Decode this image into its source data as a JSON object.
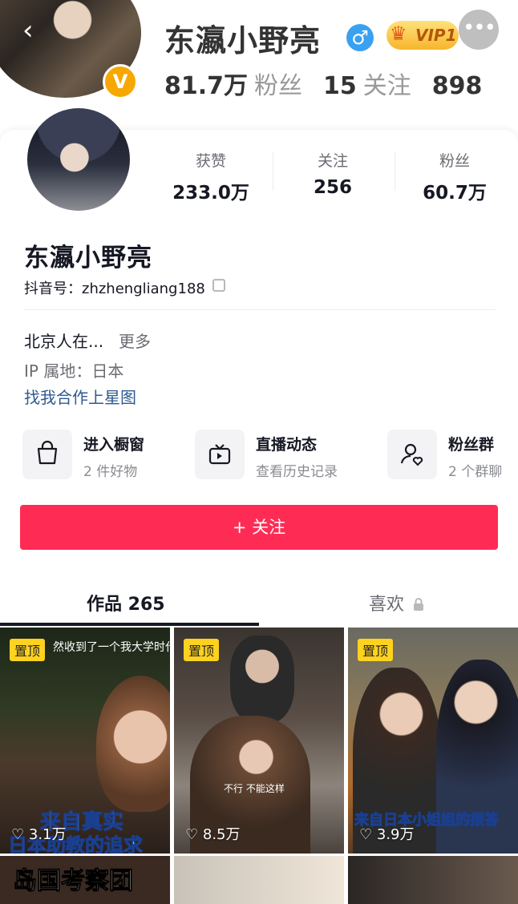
{
  "weibo": {
    "name": "东瀛小野亮",
    "gender_icon": "♂",
    "vip_badge": "VIP1",
    "verified_badge": "V",
    "followers_value": "81.7万",
    "followers_label": "粉丝",
    "following_value": "15",
    "following_label": "关注",
    "posts_value": "898"
  },
  "douyin": {
    "stats": [
      {
        "label": "获赞",
        "value": "233.0万"
      },
      {
        "label": "关注",
        "value": "256"
      },
      {
        "label": "粉丝",
        "value": "60.7万"
      }
    ],
    "name": "东瀛小野亮",
    "id_line": "抖音号：zhzhengliang188",
    "bio": "北京人在...",
    "bio_more": "更多",
    "ip": "IP 属地：日本",
    "star_link": "找我合作上星图",
    "entries": [
      {
        "title": "进入橱窗",
        "sub": "2 件好物",
        "icon": "shopping-bag-icon"
      },
      {
        "title": "直播动态",
        "sub": "查看历史记录",
        "icon": "tv-icon"
      },
      {
        "title": "粉丝群",
        "sub": "2 个群聊",
        "icon": "fan-group-icon"
      }
    ],
    "follow_button": "+ 关注",
    "tabs": {
      "works": "作品 265",
      "likes": "喜欢"
    },
    "videos": [
      {
        "pin": "置顶",
        "top_text": "然收到了一个我大学时代",
        "caption1": "来自真实",
        "caption2": "日本助教的追求",
        "likes": "3.1万"
      },
      {
        "pin": "置顶",
        "subtitle": "不行 不能这样",
        "likes": "8.5万"
      },
      {
        "pin": "置顶",
        "caption1": "来自日本小姐姐的报答",
        "likes": "3.9万"
      }
    ],
    "row2_caption": "岛国考察团"
  },
  "colors": {
    "accent": "#fe2c55",
    "link": "#2d5a91",
    "pin": "#ffd21f",
    "vip": "#f7b52c"
  }
}
